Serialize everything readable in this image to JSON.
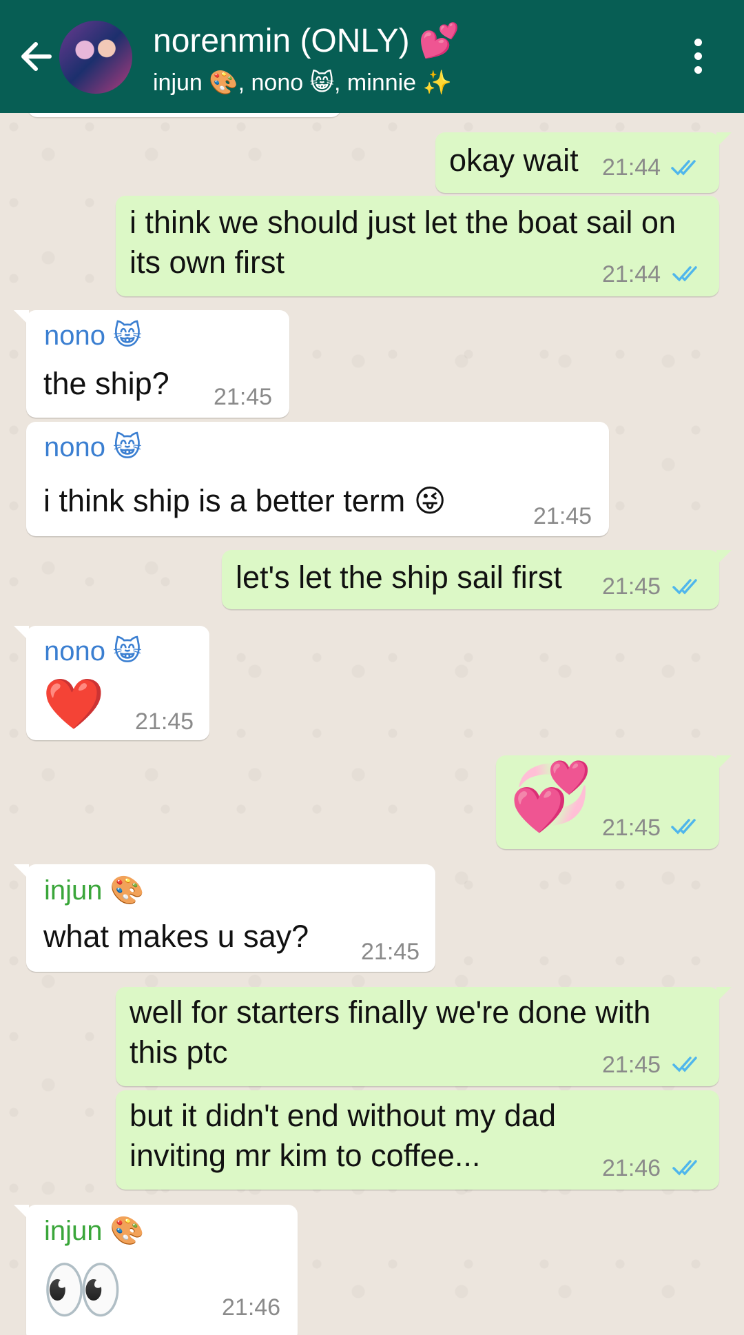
{
  "header": {
    "title": "norenmin (ONLY) 💕",
    "subtitle": "injun 🎨, nono 😸, minnie ✨",
    "avatar_icon": "group-avatar",
    "back_icon": "arrow-left-icon",
    "menu_icon": "more-vertical-icon"
  },
  "colors": {
    "header_bg": "#075e54",
    "outgoing_bubble": "#dcf8c6",
    "incoming_bubble": "#ffffff",
    "nono_name": "#3b7fd1",
    "injun_name": "#3aa63a",
    "read_ticks": "#4fb6ec"
  },
  "messages": [
    {
      "dir": "out",
      "text": "okay wait",
      "time": "21:44",
      "status": "read"
    },
    {
      "dir": "out",
      "text": "i think we should just let the boat sail on its own first",
      "time": "21:44",
      "status": "read"
    },
    {
      "dir": "in",
      "sender": "nono 😸",
      "text": "the ship?",
      "time": "21:45"
    },
    {
      "dir": "in",
      "sender": "nono 😸",
      "text": "i think ship is a better term 😜",
      "time": "21:45"
    },
    {
      "dir": "out",
      "text": "let's let the ship sail first",
      "time": "21:45",
      "status": "read"
    },
    {
      "dir": "in",
      "sender": "nono 😸",
      "text": "❤️",
      "time": "21:45"
    },
    {
      "dir": "out",
      "text": "💞",
      "time": "21:45",
      "status": "read"
    },
    {
      "dir": "in",
      "sender": "injun 🎨",
      "text": "what makes u say?",
      "time": "21:45"
    },
    {
      "dir": "out",
      "text": "well for starters finally we're done with this ptc",
      "time": "21:45",
      "status": "read"
    },
    {
      "dir": "out",
      "text": "but it didn't end without my dad inviting mr kim to coffee...",
      "time": "21:46",
      "status": "read"
    },
    {
      "dir": "in",
      "sender": "injun 🎨",
      "text": "👀",
      "time": "21:46"
    }
  ]
}
